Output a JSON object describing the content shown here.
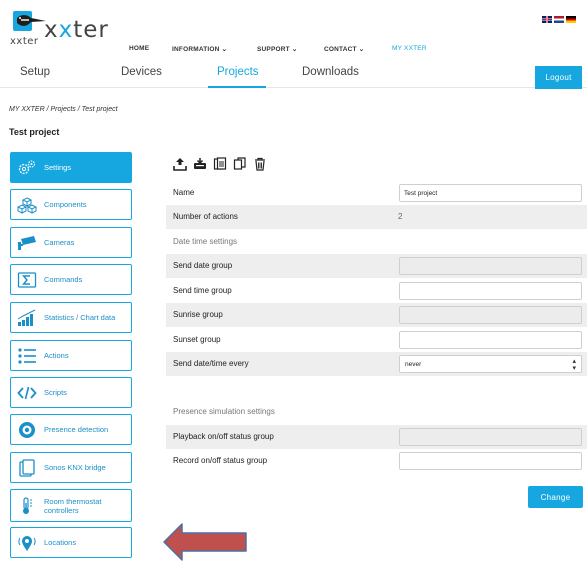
{
  "brand": {
    "name_prefix": "x",
    "name_x": "x",
    "name_suffix": "ter",
    "small": "xxter"
  },
  "language_flags": [
    "uk-flag-icon",
    "nl-flag-icon",
    "de-flag-icon"
  ],
  "top_nav": {
    "home": "HOME",
    "information": "INFORMATION ⌄",
    "support": "SUPPORT ⌄",
    "contact": "CONTACT ⌄",
    "my_xxter": "MY XXTER"
  },
  "tabs": {
    "setup": "Setup",
    "devices": "Devices",
    "projects": "Projects",
    "downloads": "Downloads",
    "active": "Projects"
  },
  "logout_label": "Logout",
  "breadcrumb": "MY XXTER / Projects / Test project",
  "page_title": "Test project",
  "sidebar": {
    "active": "Settings",
    "items": [
      {
        "label": "Settings",
        "icon": "settings-gears-icon"
      },
      {
        "label": "Components",
        "icon": "components-cubes-icon"
      },
      {
        "label": "Cameras",
        "icon": "camera-icon"
      },
      {
        "label": "Commands",
        "icon": "sum-command-icon"
      },
      {
        "label": "Statistics / Chart data",
        "icon": "bar-chart-icon"
      },
      {
        "label": "Actions",
        "icon": "list-icon"
      },
      {
        "label": "Scripts",
        "icon": "code-icon"
      },
      {
        "label": "Presence detection",
        "icon": "presence-eye-icon"
      },
      {
        "label": "Sonos KNX bridge",
        "icon": "sonos-speaker-icon"
      },
      {
        "label_line1": "Room thermostat",
        "label_line2": "controllers",
        "icon": "thermostat-icon"
      },
      {
        "label": "Locations",
        "icon": "location-pin-icon"
      }
    ]
  },
  "toolbar_icons": [
    "upload-icon",
    "download-icon",
    "copy-project-icon",
    "duplicate-icon",
    "trash-icon"
  ],
  "form": {
    "name_label": "Name",
    "name_value": "Test project",
    "actions_label": "Number of actions",
    "actions_value": "2",
    "date_time_heading": "Date time settings",
    "send_date_label": "Send date group",
    "send_date_value": "",
    "send_time_label": "Send time group",
    "send_time_value": "",
    "sunrise_label": "Sunrise group",
    "sunrise_value": "",
    "sunset_label": "Sunset group",
    "sunset_value": "",
    "send_every_label": "Send date/time every",
    "send_every_value": "never",
    "presence_heading": "Presence simulation settings",
    "playback_label": "Playback on/off status group",
    "playback_value": "",
    "record_label": "Record on/off status group",
    "record_value": ""
  },
  "change_label": "Change",
  "colors": {
    "accent": "#16a7e0",
    "arrow_fill": "#c0504d",
    "arrow_stroke": "#4a6fa5",
    "row_shade": "#eeeeee"
  }
}
